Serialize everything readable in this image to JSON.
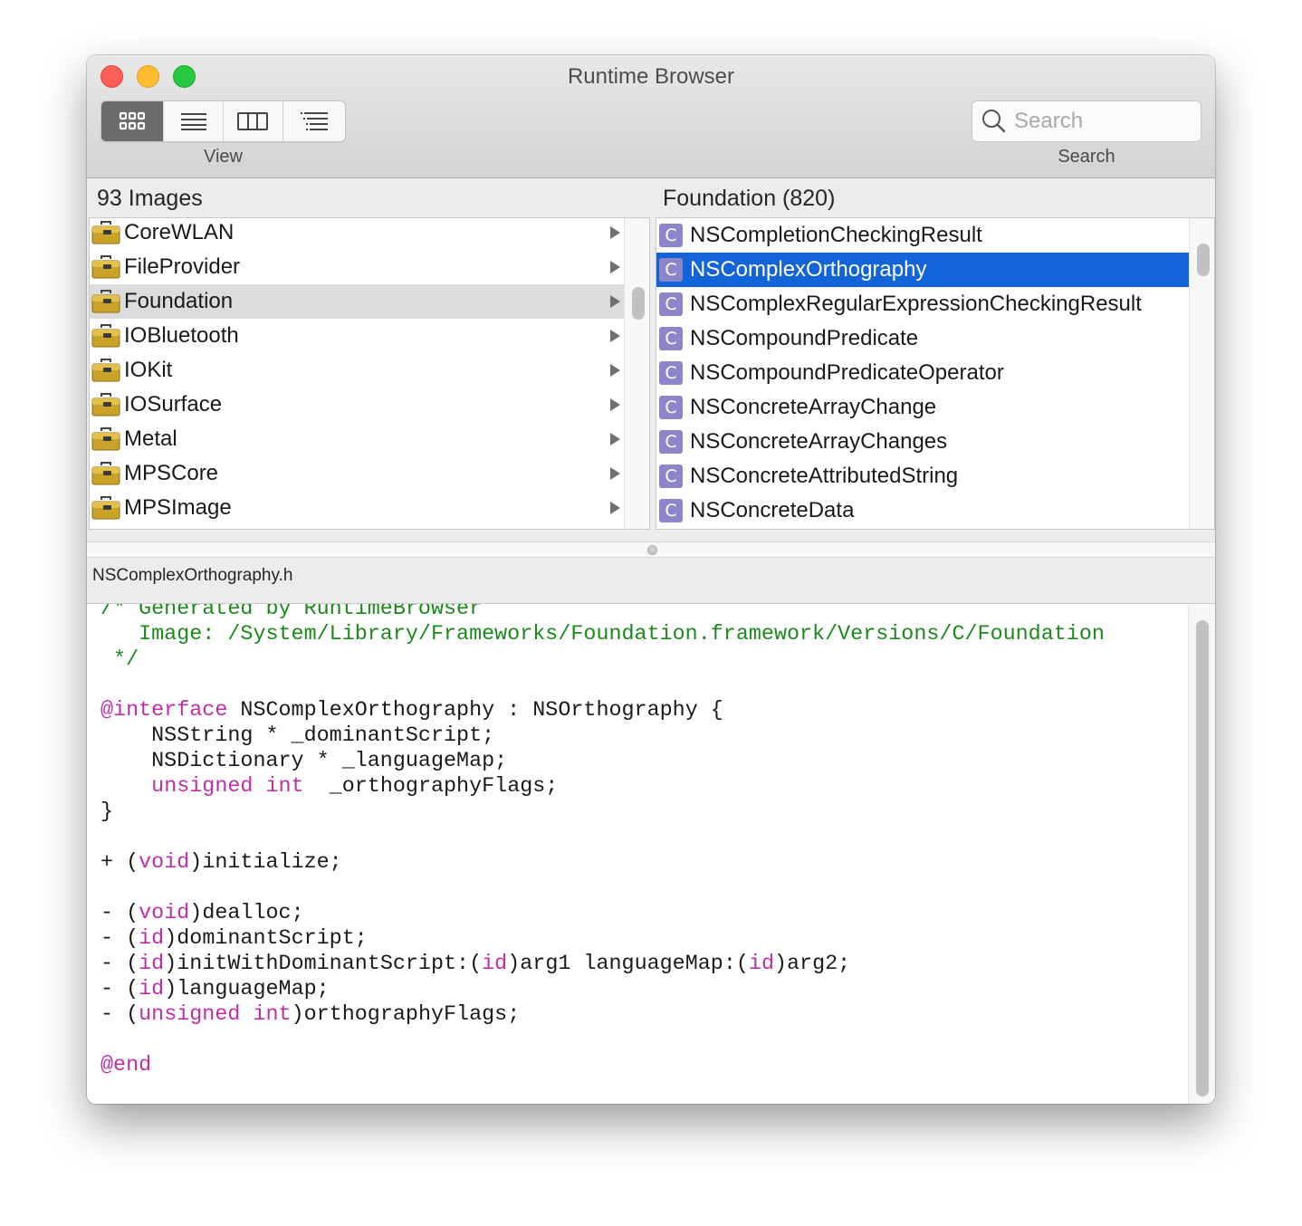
{
  "window": {
    "title": "Runtime Browser",
    "traffic_lights": [
      "close",
      "minimize",
      "zoom"
    ]
  },
  "toolbar": {
    "view_label": "View",
    "view_modes": [
      {
        "icon": "grid-icon",
        "label": "Images grid",
        "selected": true
      },
      {
        "icon": "list-icon",
        "label": "List",
        "selected": false
      },
      {
        "icon": "columns-icon",
        "label": "Columns",
        "selected": false
      },
      {
        "icon": "outline-icon",
        "label": "Outline",
        "selected": false
      }
    ],
    "search_label": "Search",
    "search_placeholder": "Search",
    "search_value": ""
  },
  "images_pane": {
    "header": "93 Images",
    "items": [
      {
        "label": "CoreWLAN",
        "icon": "toolbox-icon",
        "selected": false
      },
      {
        "label": "FileProvider",
        "icon": "toolbox-icon",
        "selected": false
      },
      {
        "label": "Foundation",
        "icon": "toolbox-icon",
        "selected": true
      },
      {
        "label": "IOBluetooth",
        "icon": "toolbox-icon",
        "selected": false
      },
      {
        "label": "IOKit",
        "icon": "toolbox-icon",
        "selected": false
      },
      {
        "label": "IOSurface",
        "icon": "toolbox-icon",
        "selected": false
      },
      {
        "label": "Metal",
        "icon": "toolbox-icon",
        "selected": false
      },
      {
        "label": "MPSCore",
        "icon": "toolbox-icon",
        "selected": false
      },
      {
        "label": "MPSImage",
        "icon": "toolbox-icon",
        "selected": false
      }
    ]
  },
  "classes_pane": {
    "header": "Foundation (820)",
    "class_badge": "C",
    "items": [
      {
        "label": "NSCompletionCheckingResult",
        "selected": false
      },
      {
        "label": "NSComplexOrthography",
        "selected": true
      },
      {
        "label": "NSComplexRegularExpressionCheckingResult",
        "selected": false
      },
      {
        "label": "NSCompoundPredicate",
        "selected": false
      },
      {
        "label": "NSCompoundPredicateOperator",
        "selected": false
      },
      {
        "label": "NSConcreteArrayChange",
        "selected": false
      },
      {
        "label": "NSConcreteArrayChanges",
        "selected": false
      },
      {
        "label": "NSConcreteAttributedString",
        "selected": false
      },
      {
        "label": "NSConcreteData",
        "selected": false
      }
    ]
  },
  "header_view": {
    "filename": "NSComplexOrthography.h",
    "lines": [
      [
        {
          "t": "/* Generated by RuntimeBrowser",
          "c": "cm"
        }
      ],
      [
        {
          "t": "   Image: /System/Library/Frameworks/Foundation.framework/Versions/C/Foundation",
          "c": "cm"
        }
      ],
      [
        {
          "t": " */",
          "c": "cm"
        }
      ],
      [],
      [
        {
          "t": "@interface",
          "c": "kw"
        },
        {
          "t": " NSComplexOrthography : NSOrthography {",
          "c": ""
        }
      ],
      [
        {
          "t": "    NSString * _dominantScript;",
          "c": ""
        }
      ],
      [
        {
          "t": "    NSDictionary * _languageMap;",
          "c": ""
        }
      ],
      [
        {
          "t": "    ",
          "c": ""
        },
        {
          "t": "unsigned int",
          "c": "kw"
        },
        {
          "t": "  _orthographyFlags;",
          "c": ""
        }
      ],
      [
        {
          "t": "}",
          "c": ""
        }
      ],
      [],
      [
        {
          "t": "+ (",
          "c": ""
        },
        {
          "t": "void",
          "c": "kw"
        },
        {
          "t": ")initialize;",
          "c": ""
        }
      ],
      [],
      [
        {
          "t": "- (",
          "c": ""
        },
        {
          "t": "void",
          "c": "kw"
        },
        {
          "t": ")dealloc;",
          "c": ""
        }
      ],
      [
        {
          "t": "- (",
          "c": ""
        },
        {
          "t": "id",
          "c": "kw"
        },
        {
          "t": ")dominantScript;",
          "c": ""
        }
      ],
      [
        {
          "t": "- (",
          "c": ""
        },
        {
          "t": "id",
          "c": "kw"
        },
        {
          "t": ")initWithDominantScript:(",
          "c": ""
        },
        {
          "t": "id",
          "c": "kw"
        },
        {
          "t": ")arg1 languageMap:(",
          "c": ""
        },
        {
          "t": "id",
          "c": "kw"
        },
        {
          "t": ")arg2;",
          "c": ""
        }
      ],
      [
        {
          "t": "- (",
          "c": ""
        },
        {
          "t": "id",
          "c": "kw"
        },
        {
          "t": ")languageMap;",
          "c": ""
        }
      ],
      [
        {
          "t": "- (",
          "c": ""
        },
        {
          "t": "unsigned int",
          "c": "kw"
        },
        {
          "t": ")orthographyFlags;",
          "c": ""
        }
      ],
      [],
      [
        {
          "t": "@end",
          "c": "kw"
        }
      ]
    ]
  },
  "colors": {
    "selection_blue": "#1264d8",
    "comment_green": "#1a8a1a",
    "keyword_magenta": "#c12ea9",
    "class_badge_purple": "#8c85c9"
  }
}
